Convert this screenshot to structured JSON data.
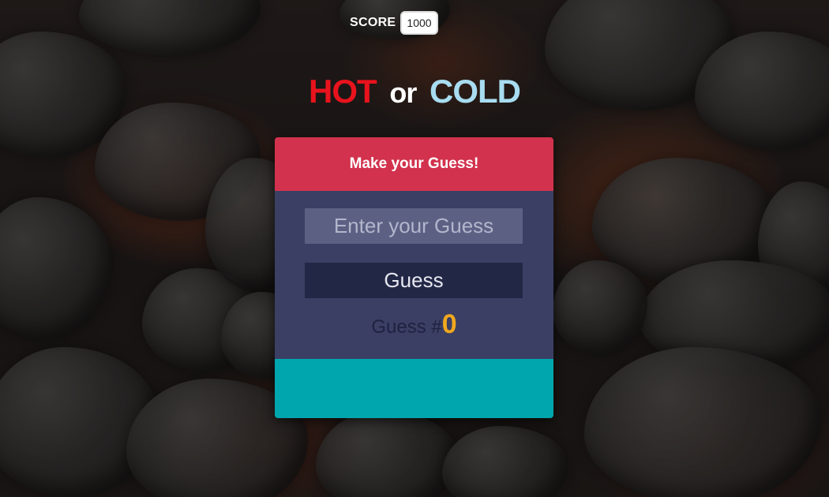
{
  "score": {
    "label": "SCORE",
    "value": "1000"
  },
  "title": {
    "hot": "HOT",
    "or": "or",
    "cold": "COLD"
  },
  "card": {
    "header": "Make your Guess!",
    "input_placeholder": "Enter your Guess",
    "input_value": "",
    "button_label": "Guess",
    "counter_prefix": "Guess #",
    "counter_value": "0",
    "feedback": ""
  },
  "colors": {
    "hot": "#e8131d",
    "cold": "#a8dcf0",
    "header": "#d2324d",
    "body": "#3b3f64",
    "footer": "#00a6ad",
    "count": "#f2a81d"
  }
}
